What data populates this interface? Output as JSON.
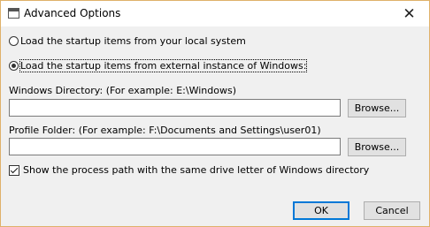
{
  "window": {
    "title": "Advanced Options",
    "close_glyph": "✕"
  },
  "options": {
    "local_label": "Load the startup items from your local system",
    "external_label": "Load the startup items from external instance of Windows:",
    "selected": "external"
  },
  "windows_directory": {
    "label": "Windows Directory:  (For example:  E:\\Windows)",
    "value": "",
    "browse_label": "Browse..."
  },
  "profile_folder": {
    "label": "Profile Folder:  (For example:  F:\\Documents and Settings\\user01)",
    "value": "",
    "browse_label": "Browse..."
  },
  "same_drive": {
    "label": "Show the process path with the same drive letter of Windows directory",
    "checked": true
  },
  "buttons": {
    "ok_label": "OK",
    "cancel_label": "Cancel"
  },
  "colors": {
    "accent": "#0078d7",
    "window_border": "#dfb16a"
  }
}
